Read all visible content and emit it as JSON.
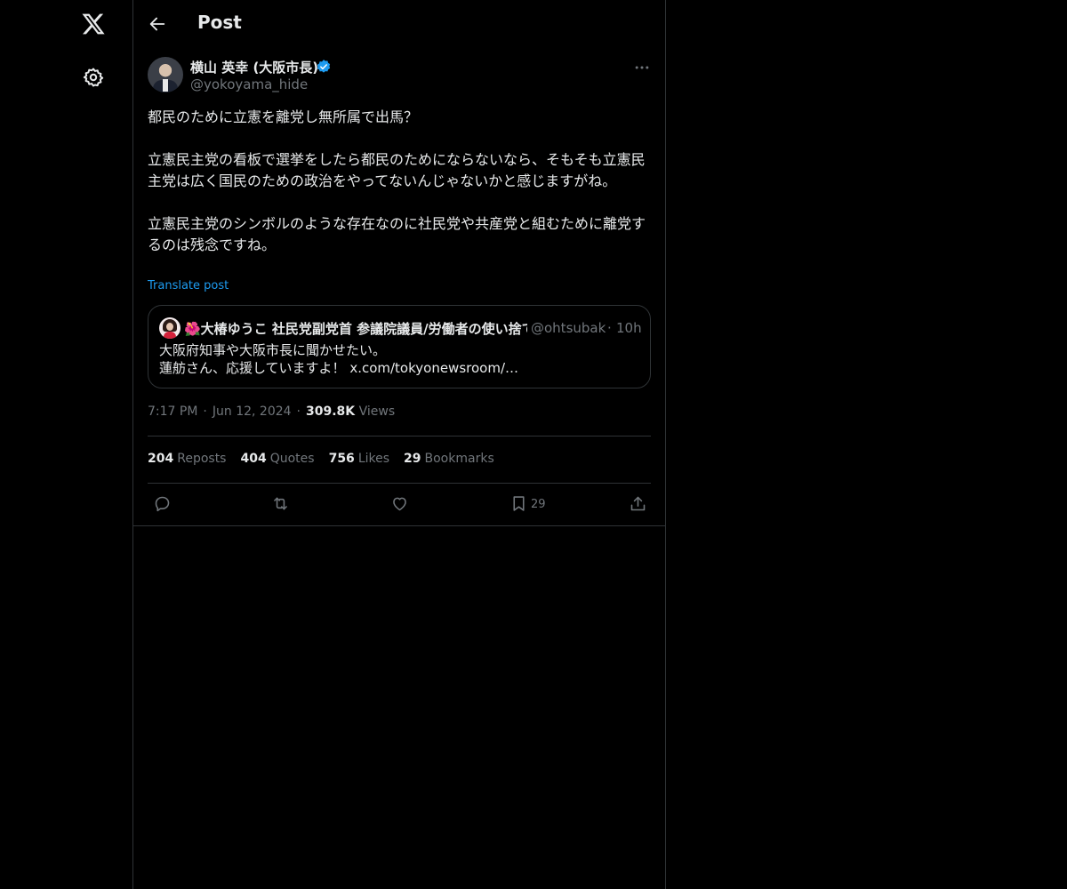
{
  "nav": {
    "logo_icon": "x-logo-icon",
    "settings_icon": "gear-icon"
  },
  "header": {
    "title": "Post",
    "back_icon": "arrow-left-icon"
  },
  "post": {
    "author_name": "横山 英幸 (大阪市長)",
    "verified": true,
    "handle": "@yokoyama_hide",
    "more_icon": "ellipsis-icon",
    "paragraphs": [
      "都民のために立憲を離党し無所属で出馬？",
      "立憲民主党の看板で選挙をしたら都民のためにならないなら、そもそも立憲民主党は広く国民のための政治をやってないんじゃないかと感じますがね。",
      "立憲民主党のシンボルのような存在なのに社民党や共産党と組むために離党するのは残念ですね。"
    ],
    "translate_label": "Translate post",
    "quote": {
      "name": "🌺大椿ゆうこ 社民党副党首 参議院議員/労働者の使い捨て",
      "handle": "@ohtsubak",
      "time": "10h",
      "lines": [
        "大阪府知事や大阪市長に聞かせたい。",
        "蓮舫さん、応援していますよ！ x.com/tokyonewsroom/…"
      ]
    },
    "time": "7:17 PM",
    "date": "Jun 12, 2024",
    "views_count": "309.8K",
    "views_label": "Views",
    "stats": [
      {
        "count": "204",
        "label": "Reposts"
      },
      {
        "count": "404",
        "label": "Quotes"
      },
      {
        "count": "756",
        "label": "Likes"
      },
      {
        "count": "29",
        "label": "Bookmarks"
      }
    ],
    "actions": {
      "reply_icon": "reply-icon",
      "repost_icon": "repost-icon",
      "like_icon": "heart-icon",
      "bookmark_icon": "bookmark-icon",
      "bookmark_count": "29",
      "share_icon": "share-icon"
    }
  },
  "colors": {
    "background": "#000000",
    "text": "#e7e9ea",
    "muted": "#71767b",
    "accent": "#1d9bf0",
    "border": "#2f3336"
  }
}
